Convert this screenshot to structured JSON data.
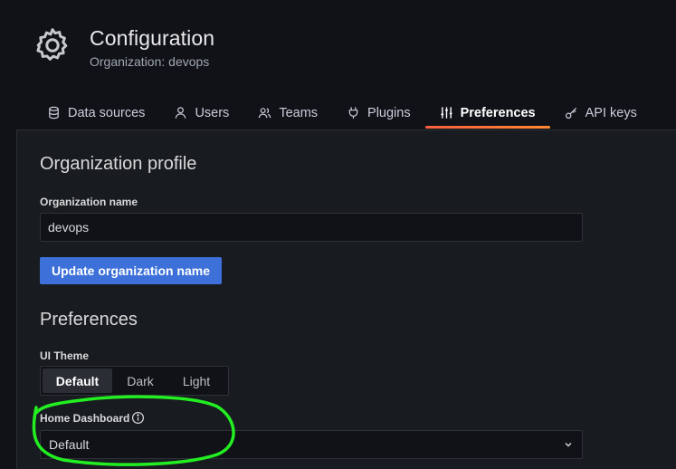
{
  "header": {
    "title": "Configuration",
    "subtitle": "Organization: devops",
    "icon": "gear-icon"
  },
  "tabs": [
    {
      "label": "Data sources",
      "icon": "database-icon",
      "active": false
    },
    {
      "label": "Users",
      "icon": "user-icon",
      "active": false
    },
    {
      "label": "Teams",
      "icon": "users-icon",
      "active": false
    },
    {
      "label": "Plugins",
      "icon": "plug-icon",
      "active": false
    },
    {
      "label": "Preferences",
      "icon": "sliders-icon",
      "active": true
    },
    {
      "label": "API keys",
      "icon": "key-icon",
      "active": false
    }
  ],
  "org_profile": {
    "heading": "Organization profile",
    "name_label": "Organization name",
    "name_value": "devops",
    "update_button": "Update organization name"
  },
  "preferences": {
    "heading": "Preferences",
    "theme_label": "UI Theme",
    "theme_options": [
      "Default",
      "Dark",
      "Light"
    ],
    "theme_selected": "Default",
    "home_dashboard_label": "Home Dashboard",
    "home_dashboard_value": "Default"
  },
  "colors": {
    "background": "#111217",
    "panel": "#181b1f",
    "primary_button": "#3d71d9",
    "active_tab_underline": "#f55f3e",
    "annotation": "#22ee22"
  }
}
